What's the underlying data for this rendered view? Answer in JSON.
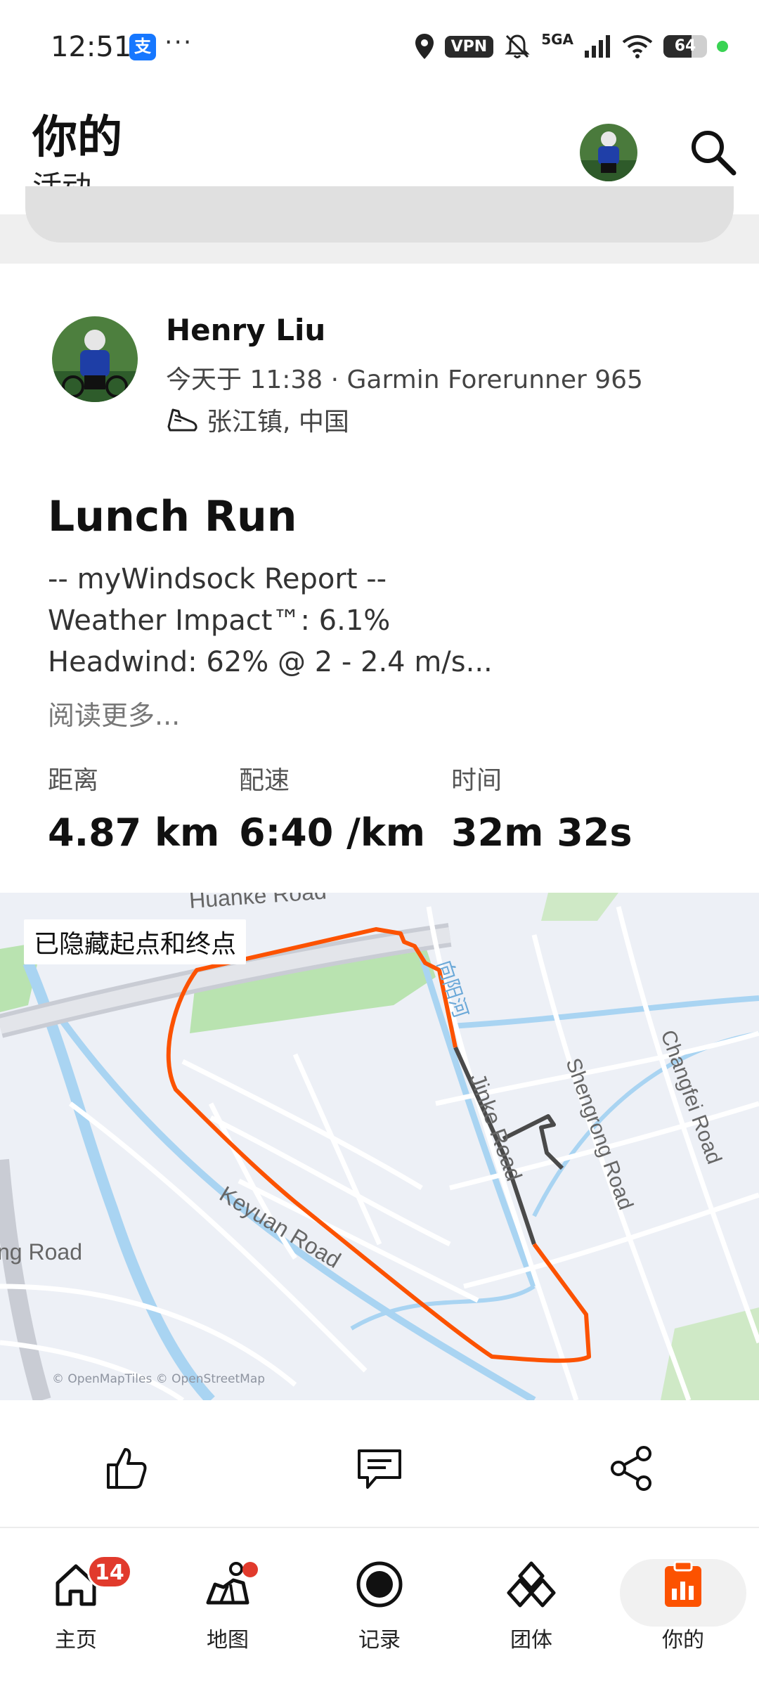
{
  "status_bar": {
    "time": "12:51",
    "alipay_glyph": "支",
    "more": "···",
    "vpn": "VPN",
    "network": "5GA",
    "battery_level": 64,
    "battery_text": "64"
  },
  "header": {
    "title": "你的",
    "subtitle": "活动"
  },
  "activity": {
    "athlete": "Henry Liu",
    "meta": "今天于 11:38 · Garmin Forerunner 965",
    "location": "张江镇, 中国",
    "title": "Lunch Run",
    "description": [
      "-- myWindsock Report --",
      "Weather Impact™: 6.1%",
      "Headwind: 62% @ 2 - 2.4 m/s..."
    ],
    "read_more": "阅读更多...",
    "stats": [
      {
        "label": "距离",
        "value": "4.87 km"
      },
      {
        "label": "配速",
        "value": "6:40 /km"
      },
      {
        "label": "时间",
        "value": "32m 32s"
      }
    ]
  },
  "map": {
    "hidden_label": "已隐藏起点和终点",
    "roads": [
      "Huanke Road",
      "Keyuan Road",
      "Shengrong Road",
      "Changfei Road",
      "ng Road",
      "Jinke Road"
    ],
    "river": "向阳河",
    "attribution": "© OpenMapTiles © OpenStreetMap",
    "route_color": "#fc5200"
  },
  "actions": {
    "like_icon": "thumbs-up-icon",
    "comment_icon": "comment-icon",
    "share_icon": "share-icon"
  },
  "nav": {
    "items": [
      {
        "label": "主页",
        "badge": "14"
      },
      {
        "label": "地图"
      },
      {
        "label": "记录"
      },
      {
        "label": "团体"
      },
      {
        "label": "你的"
      }
    ],
    "active_color": "#fc5200"
  }
}
